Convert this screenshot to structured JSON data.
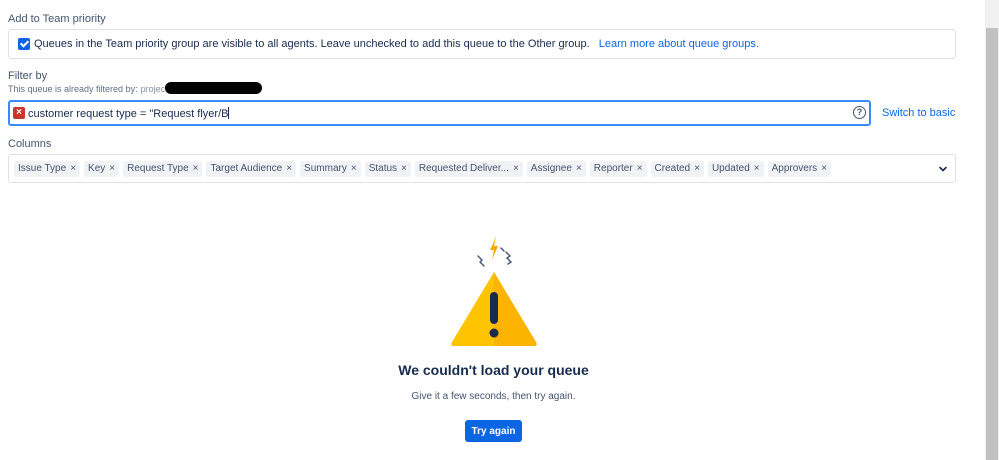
{
  "team_priority": {
    "heading": "Add to Team priority",
    "checked": true,
    "description": "Queues in the Team priority group are visible to all agents. Leave unchecked to add this queue to the Other group.",
    "learn_more": "Learn more about queue groups."
  },
  "filter": {
    "heading": "Filter by",
    "already_filtered": "This queue is already filtered by:",
    "project_prefix": "project =",
    "jql_value": "customer request type = \"Request flyer/B",
    "help_symbol": "?",
    "switch_label": "Switch to basic"
  },
  "columns": {
    "heading": "Columns",
    "items": [
      "Issue Type",
      "Key",
      "Request Type",
      "Target Audience",
      "Summary",
      "Status",
      "Requested Deliver...",
      "Assignee",
      "Reporter",
      "Created",
      "Updated",
      "Approvers"
    ],
    "remove_symbol": "×"
  },
  "error_state": {
    "title": "We couldn't load your queue",
    "message": "Give it a few seconds, then try again.",
    "button": "Try again"
  },
  "colors": {
    "primary": "#0c66e4",
    "error": "#c9372c",
    "warning": "#fca700"
  },
  "icons": {
    "checkbox": "checkbox-checked-icon",
    "error": "error-x-icon",
    "help": "question-circle-icon",
    "chevron": "chevron-down-icon",
    "illustration": "warning-triangle-icon"
  }
}
